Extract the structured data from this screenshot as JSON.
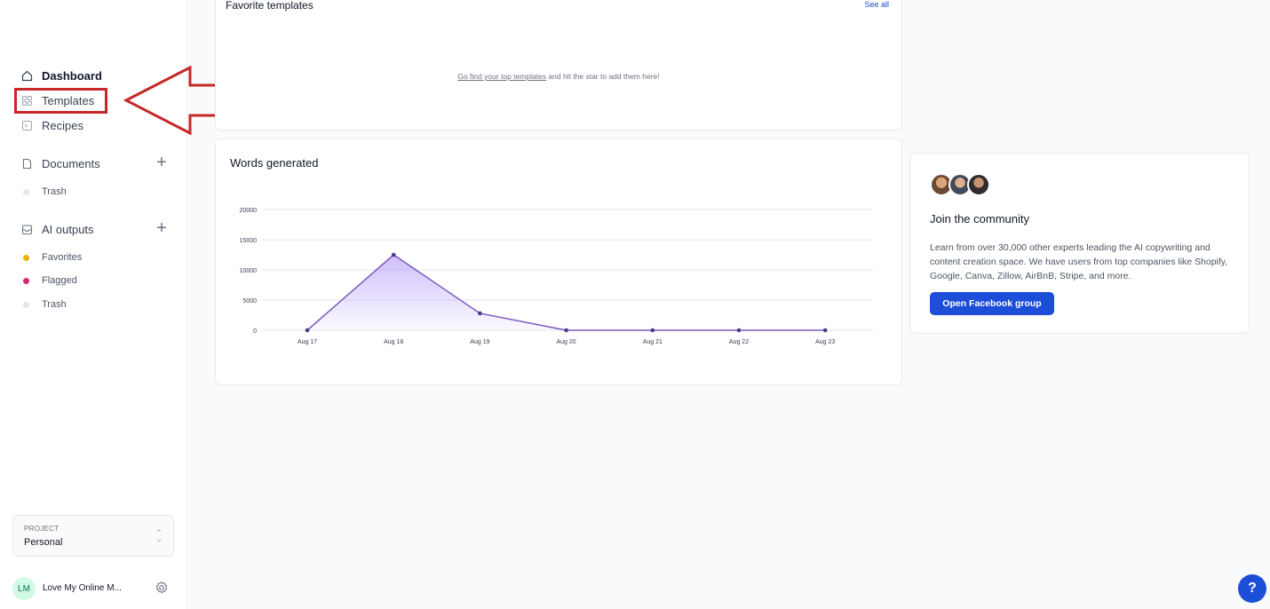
{
  "sidebar": {
    "nav": [
      {
        "label": "Dashboard",
        "icon": "home-icon"
      },
      {
        "label": "Templates",
        "icon": "grid-icon"
      },
      {
        "label": "Recipes",
        "icon": "recipe-icon"
      }
    ],
    "documents": {
      "label": "Documents",
      "icon": "document-icon",
      "trash": "Trash"
    },
    "ai_outputs": {
      "label": "AI outputs",
      "icon": "inbox-icon",
      "items": [
        {
          "label": "Favorites",
          "color": "#eab308"
        },
        {
          "label": "Flagged",
          "color": "#db2777"
        },
        {
          "label": "Trash",
          "color": "#e5e7eb"
        }
      ]
    },
    "project": {
      "label": "PROJECT",
      "name": "Personal"
    },
    "user": {
      "initials": "LM",
      "name": "Love My Online M..."
    }
  },
  "favorites": {
    "title": "Favorite templates",
    "see_all": "See all",
    "link_text": "Go find your top templates",
    "rest_text": " and hit the star to add them here!"
  },
  "words": {
    "title": "Words generated"
  },
  "chart_data": {
    "type": "area",
    "categories": [
      "Aug 17",
      "Aug 18",
      "Aug 19",
      "Aug 20",
      "Aug 21",
      "Aug 22",
      "Aug 23"
    ],
    "series": [
      {
        "values": [
          0,
          12500,
          2800,
          0,
          0,
          0,
          0
        ]
      }
    ],
    "yticks": [
      0,
      5000,
      10000,
      15000,
      20000
    ],
    "ylim": [
      0,
      20000
    ],
    "grid": true,
    "line_color": "#7c5cbf",
    "fill_color": "#a78bfa"
  },
  "community": {
    "title": "Join the community",
    "description": "Learn from over 30,000 other experts leading the AI copywriting and content creation space. We have users from top companies like Shopify, Google, Canva, Zillow, AirBnB, Stripe, and more.",
    "button": "Open Facebook group"
  },
  "help": {
    "label": "?"
  },
  "annotation": {
    "color": "#c62828"
  }
}
